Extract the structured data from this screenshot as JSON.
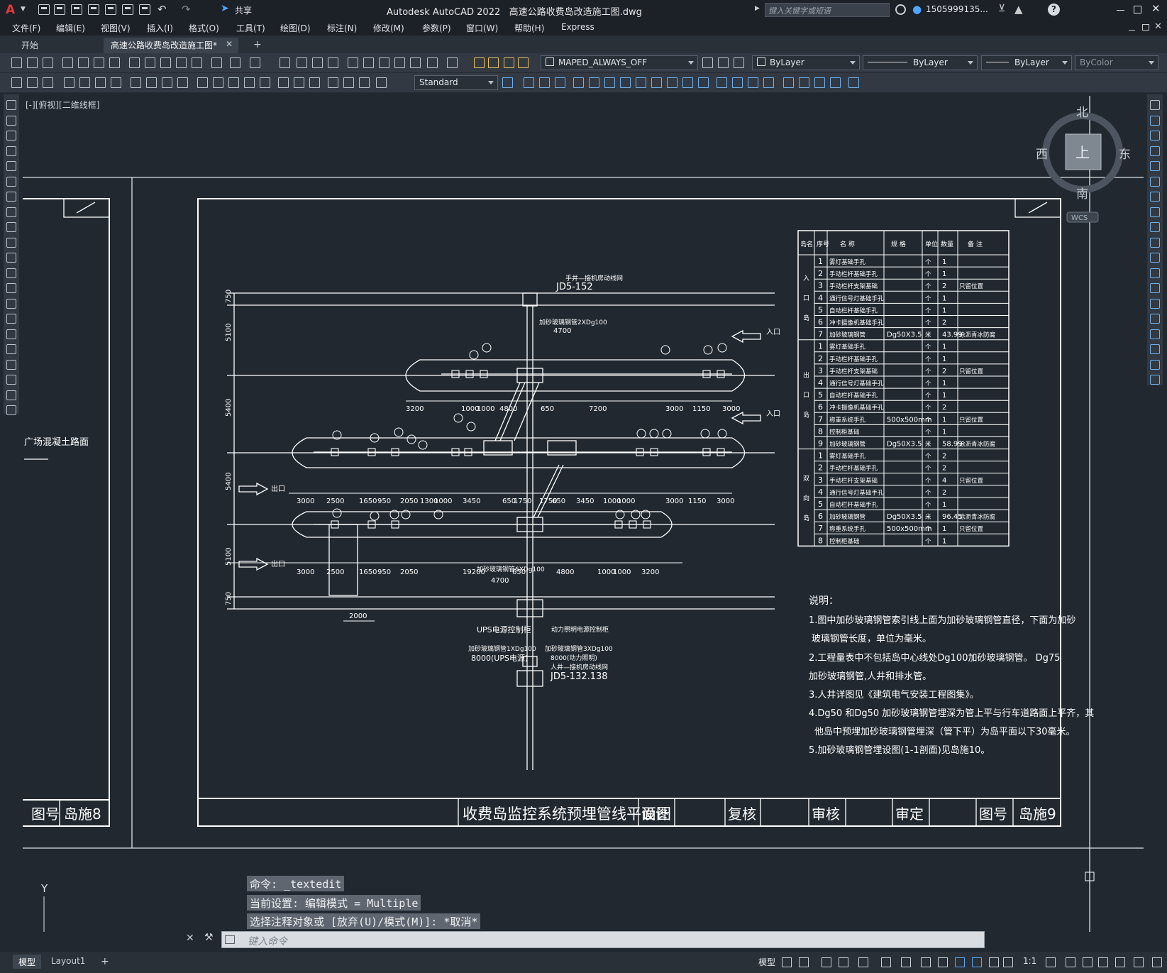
{
  "app": {
    "logo": "A",
    "title": "Autodesk AutoCAD 2022",
    "file": "高速公路收费岛改造施工图.dwg",
    "share_label": "共享",
    "search_placeholder": "键入关键字或短语",
    "user": "1505999135...",
    "help": "?"
  },
  "menus": [
    "文件(F)",
    "编辑(E)",
    "视图(V)",
    "插入(I)",
    "格式(O)",
    "工具(T)",
    "绘图(D)",
    "标注(N)",
    "修改(M)",
    "参数(P)",
    "窗口(W)",
    "帮助(H)",
    "Express"
  ],
  "tabs": [
    {
      "label": "开始"
    },
    {
      "label": "高速公路收费岛改造施工图*",
      "close": "✕"
    }
  ],
  "tab_add": "+",
  "toolbar": {
    "layer": "MAPED_ALWAYS_OFF",
    "color": "ByLayer",
    "linetype": "ByLayer",
    "lineweight": "ByLayer",
    "plotstyle": "ByColor",
    "textstyle": "Standard"
  },
  "viewport": {
    "label": "[-][俯视][二维线框]",
    "viewcube": {
      "north": "北",
      "south": "南",
      "east": "东",
      "west": "西",
      "face": "上",
      "wcs": "WCS"
    }
  },
  "drawing": {
    "left_sheet": {
      "number_label": "图号",
      "number": "岛施8",
      "road_label": "广场混凝土路面"
    },
    "title_block": {
      "title": "收费岛监控系统预埋管线平面图",
      "design": "设计",
      "check": "复核",
      "review": "审核",
      "approve": "审定",
      "number_label": "图号",
      "number": "岛施9"
    },
    "table_headers": [
      "岛名",
      "序号",
      "名 称",
      "规 格",
      "单位",
      "数量",
      "备 注"
    ],
    "table_groups": [
      {
        "name": "入口岛",
        "rows": [
          [
            "1",
            "雾灯基础手孔",
            "",
            "个",
            "1",
            ""
          ],
          [
            "2",
            "手动栏杆基础手孔",
            "",
            "个",
            "1",
            ""
          ],
          [
            "3",
            "手动栏杆支架基础",
            "",
            "个",
            "2",
            "只留位置"
          ],
          [
            "4",
            "通行信号灯基础手孔",
            "",
            "个",
            "1",
            ""
          ],
          [
            "5",
            "自动栏杆基础手孔",
            "",
            "个",
            "1",
            ""
          ],
          [
            "6",
            "冲卡摄像机基础手孔",
            "",
            "个",
            "2",
            ""
          ],
          [
            "7",
            "加砂玻璃钢管",
            "Dg50X3.5",
            "米",
            "43.99",
            "涂沥青冰防腐"
          ]
        ]
      },
      {
        "name": "出口岛",
        "rows": [
          [
            "1",
            "雾灯基础手孔",
            "",
            "个",
            "1",
            ""
          ],
          [
            "2",
            "手动栏杆基础手孔",
            "",
            "个",
            "1",
            ""
          ],
          [
            "3",
            "手动栏杆支架基础",
            "",
            "个",
            "2",
            "只留位置"
          ],
          [
            "4",
            "通行信号灯基础手孔",
            "",
            "个",
            "1",
            ""
          ],
          [
            "5",
            "自动栏杆基础手孔",
            "",
            "个",
            "1",
            ""
          ],
          [
            "6",
            "冲卡摄像机基础手孔",
            "",
            "个",
            "2",
            ""
          ],
          [
            "7",
            "称重系统手孔",
            "500x500mm",
            "个",
            "1",
            "只留位置"
          ],
          [
            "8",
            "控制柜基础",
            "",
            "个",
            "1",
            ""
          ],
          [
            "9",
            "加砂玻璃钢管",
            "Dg50X3.5",
            "米",
            "58.99",
            "涂沥青冰防腐"
          ]
        ]
      },
      {
        "name": "双向岛",
        "rows": [
          [
            "1",
            "雾灯基础手孔",
            "",
            "个",
            "2",
            ""
          ],
          [
            "2",
            "手动栏杆基础手孔",
            "",
            "个",
            "2",
            ""
          ],
          [
            "3",
            "手动栏杆支架基础",
            "",
            "个",
            "4",
            "只留位置"
          ],
          [
            "4",
            "通行信号灯基础手孔",
            "",
            "个",
            "2",
            ""
          ],
          [
            "5",
            "自动栏杆基础手孔",
            "",
            "个",
            "1",
            ""
          ],
          [
            "6",
            "加砂玻璃钢管",
            "Dg50X3.5",
            "米",
            "96.45",
            "涂沥青冰防腐"
          ],
          [
            "7",
            "称重系统手孔",
            "500x500mm",
            "个",
            "1",
            "只留位置"
          ],
          [
            "8",
            "控制柜基础",
            "",
            "个",
            "1",
            ""
          ]
        ]
      }
    ],
    "notes": {
      "heading": "说明：",
      "lines": [
        "1.图中加砂玻璃钢管索引线上面为加砂玻璃钢管直径，下面为加砂",
        "玻璃钢管长度，单位为毫米。",
        "2.工程量表中不包括岛中心线处Dg100加砂玻璃钢管。 Dg75",
        "加砂玻璃钢管,人井和排水管。",
        "3.人井详图见《建筑电气安装工程图集》。",
        "4.Dg50 和Dg50 加砂玻璃钢管埋深为管上平与行车道路面上平齐，其",
        "他岛中预埋加砂玻璃钢管埋深（管下平）为岛平面以下30毫米。",
        "5.加砂玻璃钢管埋设图(1-1剖面)见岛施10。"
      ]
    },
    "plan": {
      "top_label": "手井—接机房动线网",
      "top_code": "JD5-152",
      "bottom_code": "JD5-132.138",
      "bottom_label": "人井—接机房动线网",
      "entry_label": "入口",
      "exit_label": "出口",
      "ups_label": "UPS电源控制柜",
      "ups_note": "加砂玻璃钢管1XDg100",
      "ups_len": "8000(UPS电源)",
      "power_note": "加砂玻璃钢管3XDg100",
      "power_len": "8000(动力照明)",
      "power_label": "动力照明电源控制柜",
      "pipe_top": "加砂玻璃钢管2XDg100",
      "pipe_top_len": "4700",
      "pipe_bottom": "加砂玻璃钢管6XDg100",
      "pipe_bottom_len": "4700",
      "side_dims": [
        "750",
        "5100",
        "5400",
        "5400",
        "5100",
        "750"
      ],
      "span": "2000",
      "row1_dims": [
        "3200",
        "1000",
        "1000",
        "4800",
        "650",
        "7200",
        "3000",
        "1150",
        "3000"
      ],
      "row2_dims": [
        "3000",
        "2500",
        "1650",
        "950",
        "2050",
        "1300",
        "1000",
        "3450",
        "650",
        "1750",
        "1750",
        "650",
        "3450",
        "1000",
        "1000",
        "3000",
        "1150",
        "3000"
      ],
      "row3_dims": [
        "3000",
        "2500",
        "1650",
        "950",
        "2050",
        "19200",
        "650",
        "4800",
        "1000",
        "1000",
        "3200"
      ]
    }
  },
  "command": {
    "history": [
      "命令: _textedit",
      "当前设置: 编辑模式 = Multiple",
      "选择注释对象或 [放弃(U)/模式(M)]: *取消*"
    ],
    "placeholder": "键入命令"
  },
  "ucs": {
    "x": "X",
    "y": "Y"
  },
  "status": {
    "tabs": [
      "模型",
      "Layout1"
    ],
    "add": "+",
    "model_label": "模型",
    "scale": "1:1"
  }
}
